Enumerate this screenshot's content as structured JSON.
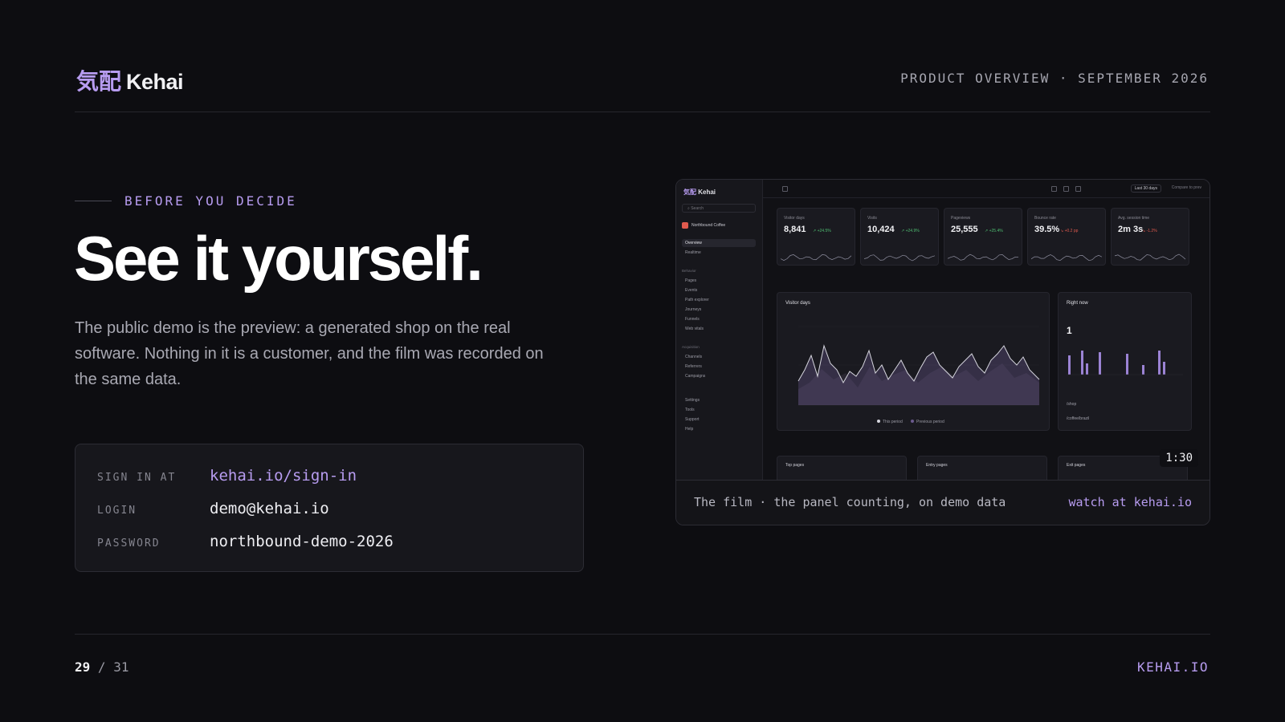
{
  "header": {
    "brand_kanji": "気配",
    "brand_name": "Kehai",
    "meta": "PRODUCT OVERVIEW · SEPTEMBER 2026"
  },
  "hero": {
    "eyebrow": "BEFORE YOU DECIDE",
    "headline": "See it yourself.",
    "body": "The public demo is the preview: a generated shop on the real software. Nothing in it is a customer, and the film was recorded on the same data."
  },
  "credentials": [
    {
      "label": "SIGN IN AT",
      "value": "kehai.io/sign-in"
    },
    {
      "label": "LOGIN",
      "value": "demo@kehai.io"
    },
    {
      "label": "PASSWORD",
      "value": "northbound-demo-2026"
    }
  ],
  "preview": {
    "app_name": "Kehai",
    "search_placeholder": "Search",
    "site_name": "Northbound Coffee",
    "nav_primary": [
      "Overview",
      "Realtime"
    ],
    "nav_behavior_head": "Behavior",
    "nav_behavior": [
      "Pages",
      "Events",
      "Path explorer",
      "Journeys",
      "Funnels",
      "Web vitals"
    ],
    "nav_acquisition_head": "Acquisition",
    "nav_acquisition": [
      "Channels",
      "Referrers",
      "Campaigns"
    ],
    "nav_footer": [
      "Settings",
      "Tools",
      "Support",
      "Help"
    ],
    "range_label": "Last 30 days",
    "compare_label": "Compare to prev",
    "kpis": [
      {
        "label": "Visitor days",
        "value": "8,841",
        "delta": "↗ +24.5%",
        "trend": "up"
      },
      {
        "label": "Visits",
        "value": "10,424",
        "delta": "↗ +24.9%",
        "trend": "up"
      },
      {
        "label": "Pageviews",
        "value": "25,555",
        "delta": "↗ +25.4%",
        "trend": "up"
      },
      {
        "label": "Bounce rate",
        "value": "39.5%",
        "delta": "↘ +0.2 pp",
        "trend": "down"
      },
      {
        "label": "Avg. session time",
        "value": "2m 3s",
        "delta": "↘ -1.2%",
        "trend": "down"
      }
    ],
    "chart_title": "Visitor days",
    "chart_legend": [
      "This period",
      "Previous period"
    ],
    "right_title": "Right now",
    "right_value": "1",
    "right_rows": [
      "/shop",
      "/coffee/brazil"
    ],
    "bottom_cards": [
      "Top pages",
      "Entry pages",
      "Exit pages"
    ],
    "timer": "1:30"
  },
  "caption": {
    "text": "The film · the panel counting, on demo data",
    "link": "watch at kehai.io"
  },
  "footer": {
    "page_current": "29",
    "page_separator": "/",
    "page_total": "31",
    "site": "KEHAI.IO"
  },
  "colors": {
    "background": "#0d0d11",
    "accent": "#b79cf0",
    "up": "#4fbf72",
    "down": "#e05a4e"
  }
}
